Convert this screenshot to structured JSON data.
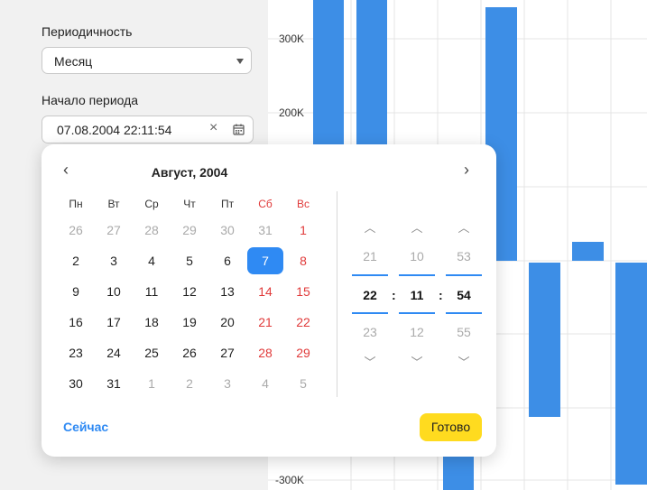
{
  "form": {
    "periodicity_label": "Периодичность",
    "periodicity_value": "Месяц",
    "start_label": "Начало периода",
    "start_value": "07.08.2004 22:11:54"
  },
  "calendar": {
    "month_title": "Август, 2004",
    "weekdays": [
      "Пн",
      "Вт",
      "Ср",
      "Чт",
      "Пт",
      "Сб",
      "Вс"
    ],
    "weeks": [
      [
        "26",
        "27",
        "28",
        "29",
        "30",
        "31",
        "1"
      ],
      [
        "2",
        "3",
        "4",
        "5",
        "6",
        "7",
        "8"
      ],
      [
        "9",
        "10",
        "11",
        "12",
        "13",
        "14",
        "15"
      ],
      [
        "16",
        "17",
        "18",
        "19",
        "20",
        "21",
        "22"
      ],
      [
        "23",
        "24",
        "25",
        "26",
        "27",
        "28",
        "29"
      ],
      [
        "30",
        "31",
        "1",
        "2",
        "3",
        "4",
        "5"
      ]
    ],
    "selected_day": "7",
    "weekend_color": "#e03a3a",
    "accent_color": "#2f8af3"
  },
  "time": {
    "hours": {
      "prev": "21",
      "current": "22",
      "next": "23"
    },
    "minutes": {
      "prev": "10",
      "current": "11",
      "next": "12"
    },
    "seconds": {
      "prev": "53",
      "current": "54",
      "next": "55"
    },
    "separator": ":"
  },
  "buttons": {
    "now_label": "Сейчас",
    "done_label": "Готово",
    "done_color": "#ffdb1f"
  },
  "chart_data": {
    "type": "bar",
    "y_tick_labels": [
      "300K",
      "200K",
      "-300K"
    ],
    "visible_values_approx": [
      430000,
      430000,
      -320000,
      335000,
      -215000,
      25000,
      -305000
    ],
    "bar_color": "#3d8ee6"
  }
}
